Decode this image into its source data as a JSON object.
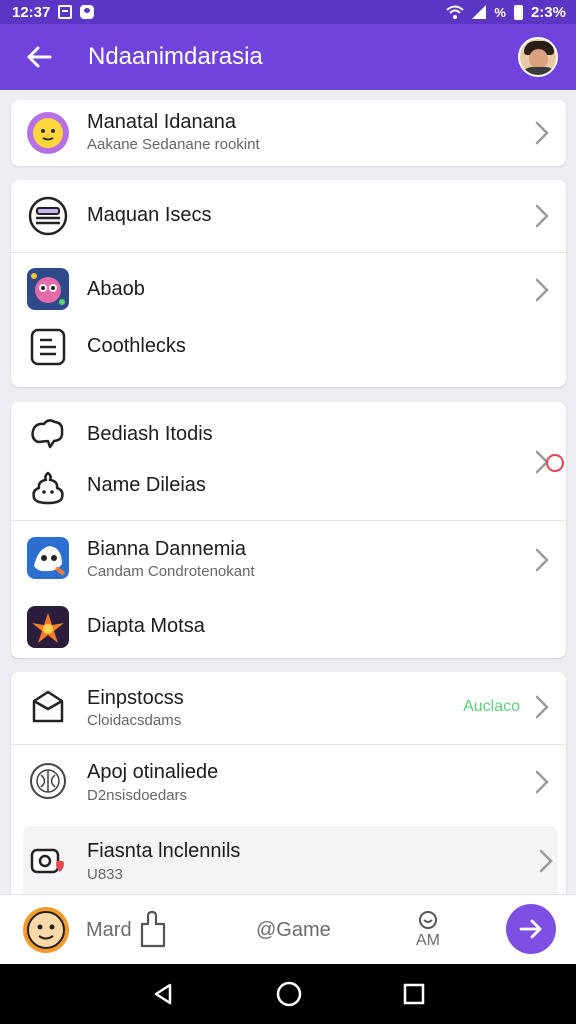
{
  "status_bar": {
    "time_left": "12:37",
    "time_right": "2:3%"
  },
  "app_bar": {
    "title": "Ndaanimdarasia"
  },
  "cards": [
    {
      "rows": [
        {
          "icon": "smiley-face-icon",
          "title": "Manatal Idanana",
          "subtitle": "Aakane Sedanane rookint"
        }
      ]
    },
    {
      "rows": [
        {
          "icon": "stack-icon",
          "title": "Maquan Isecs"
        },
        {
          "icon": "game-app-icon",
          "title": "Abaob"
        },
        {
          "icon": "document-icon",
          "title": "Coothlecks"
        }
      ]
    },
    {
      "rows": [
        {
          "icon": "chat-bubble-icon",
          "title": "Bediash Itodis"
        },
        {
          "icon": "poop-icon",
          "title": "Name Dileias"
        },
        {
          "icon": "character-app-icon",
          "title": "Bianna Dannemia",
          "subtitle": "Candam Condrotenokant"
        },
        {
          "icon": "fire-app-icon",
          "title": "Diapta Motsa"
        }
      ]
    },
    {
      "rows": [
        {
          "icon": "box-icon",
          "title": "Einpstocss",
          "subtitle": "Cloidacsdams",
          "badge": "Auclaco"
        },
        {
          "icon": "globe-icon",
          "title": "Apoj otinaliede",
          "subtitle": "D2nsisdoedars"
        },
        {
          "icon": "camera-heart-icon",
          "title": "Fiasnta lnclennils",
          "subtitle": "U833"
        }
      ]
    }
  ],
  "bottom_nav": {
    "items": [
      {
        "icon": "face-icon",
        "label": ""
      },
      {
        "icon": "puzzle-icon",
        "label": "Mard"
      },
      {
        "icon": "at-icon",
        "label": "@Game"
      },
      {
        "icon": "balloon-icon",
        "label": "AM"
      }
    ],
    "fab_icon": "arrow-right-icon"
  },
  "colors": {
    "primary": "#7043dc",
    "status_bar": "#5c35c4",
    "fab": "#7d4fe3",
    "badge": "#5ad27a",
    "notification": "#e2484f"
  }
}
